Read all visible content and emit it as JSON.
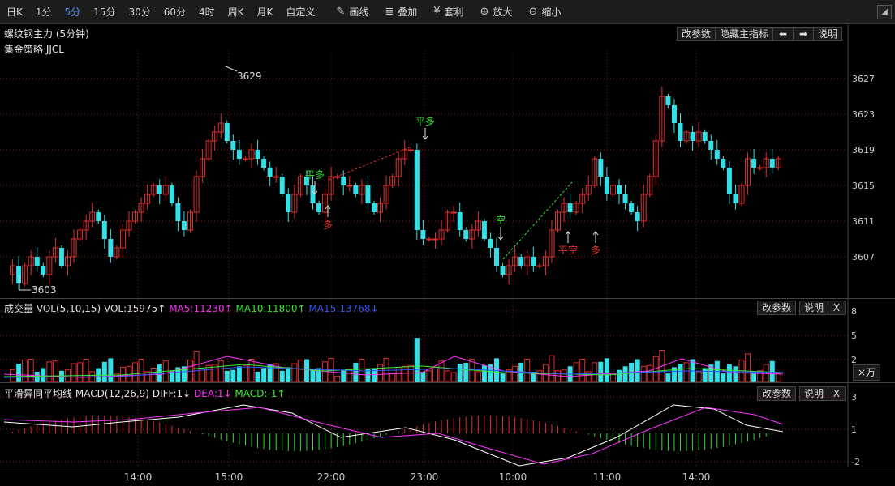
{
  "toolbar": {
    "periods": [
      "日K",
      "1分",
      "5分",
      "15分",
      "30分",
      "60分",
      "4时",
      "周K",
      "月K",
      "自定义"
    ],
    "active_period": "5分",
    "tools": [
      {
        "icon": "pencil-icon",
        "glyph": "✎",
        "label": "画线"
      },
      {
        "icon": "stack-icon",
        "glyph": "≣",
        "label": "叠加"
      },
      {
        "icon": "money-bag-icon",
        "glyph": "¥",
        "label": "套利"
      },
      {
        "icon": "zoom-in-icon",
        "glyph": "⊕",
        "label": "放大"
      },
      {
        "icon": "zoom-out-icon",
        "glyph": "⊖",
        "label": "缩小"
      }
    ],
    "collapse_glyph": "◢"
  },
  "main": {
    "title": "螺纹钢主力 (5分钟)",
    "strategy": "集金策略 JJCL",
    "buttons": {
      "params": "改参数",
      "hide_indicator": "隐藏主指标",
      "left": "⬅",
      "right": "➡",
      "help": "说明"
    },
    "y_ticks": [
      "3627",
      "3623",
      "3619",
      "3615",
      "3611",
      "3607"
    ],
    "high_label": "3629",
    "low_label": "3603",
    "signals": [
      {
        "text": "平多",
        "color": "#33dd33"
      },
      {
        "text": "多",
        "color": "#e03030"
      },
      {
        "text": "平多",
        "color": "#33dd33"
      },
      {
        "text": "空",
        "color": "#33dd33"
      },
      {
        "text": "平空",
        "color": "#e03030"
      },
      {
        "text": "多",
        "color": "#e03030"
      }
    ]
  },
  "volume": {
    "title": "成交量",
    "params": "VOL(5,10,15)",
    "vol": "VOL:15975↑",
    "ma5": "MA5:11230↑",
    "ma10": "MA10:11800↑",
    "ma15": "MA15:13768↓",
    "colors": {
      "ma5": "#ff33ff",
      "ma10": "#33ee33",
      "ma15": "#3355ff",
      "vol": "#e6e6e6"
    },
    "buttons": {
      "params": "改参数",
      "help": "说明",
      "close": "X"
    },
    "y_ticks": [
      "8",
      "5",
      "2"
    ],
    "unit": "×万"
  },
  "macd": {
    "title": "平滑异同平均线",
    "params": "MACD(12,26,9)",
    "diff": "DIFF:1↓",
    "dea": "DEA:1↓",
    "macd": "MACD:-1↑",
    "colors": {
      "diff": "#e6e6e6",
      "dea": "#ff33ff",
      "macd": "#33ee33"
    },
    "buttons": {
      "params": "改参数",
      "help": "说明",
      "close": "X"
    },
    "y_ticks": [
      "3",
      "1",
      "-2"
    ]
  },
  "time_axis": [
    "14:00",
    "15:00",
    "22:00",
    "23:00",
    "10:00",
    "11:00",
    "14:00"
  ],
  "colors": {
    "up": "#e03030",
    "down": "#33e0e8",
    "diff_line": "#ffffff",
    "dea_line": "#ff33ff",
    "grid": "#7a1a1a"
  }
}
